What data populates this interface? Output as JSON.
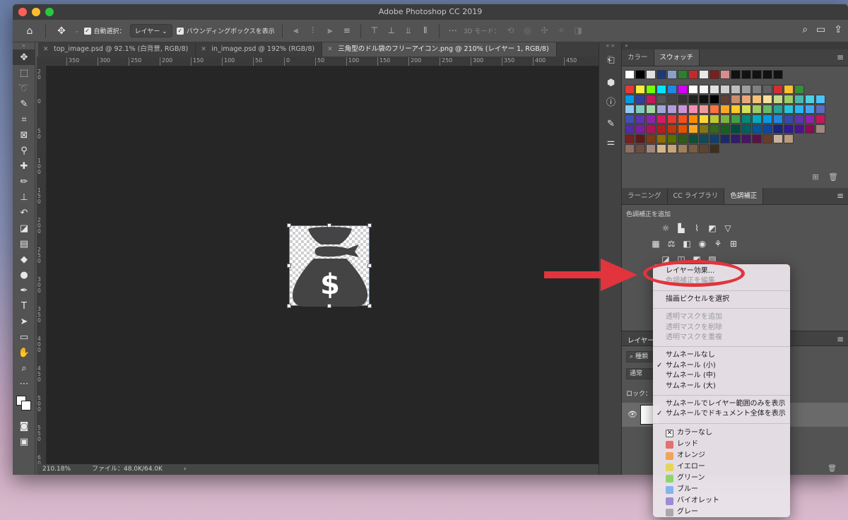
{
  "window": {
    "title": "Adobe Photoshop CC 2019"
  },
  "options_bar": {
    "auto_select_label": "自動選択：",
    "auto_select_value": "レイヤー",
    "bounding_box_label": "バウンディングボックスを表示",
    "mode_3d_label": "3D モード："
  },
  "tabs": [
    {
      "label": "top_image.psd @ 92.1% (白背景, RGB/8)"
    },
    {
      "label": "in_image.psd @ 192% (RGB/8)"
    },
    {
      "label": "三角型のドル袋のフリーアイコン.png @ 210% (レイヤー 1, RGB/8)"
    }
  ],
  "ruler_top": [
    "350",
    "300",
    "250",
    "200",
    "150",
    "100",
    "50",
    "0",
    "50",
    "100",
    "150",
    "200",
    "250",
    "300",
    "350",
    "400",
    "450"
  ],
  "ruler_left": [
    "2 0",
    "0",
    "5 0",
    "1 0 0",
    "1 5 0",
    "2 0 0",
    "2 5 0",
    "3 0 0",
    "3 5 0",
    "4 0 0",
    "4 5 0",
    "5 0 0",
    "5 5 0",
    "6 0 0"
  ],
  "status": {
    "zoom": "210.18%",
    "file": "ファイル：48.0K/64.0K",
    "chevron": "›"
  },
  "swatch_panel": {
    "tabs": [
      "カラー",
      "スウォッチ"
    ]
  },
  "adjust_panel": {
    "tabs": [
      "ラーニング",
      "CC ライブラリ",
      "色調補正"
    ],
    "heading": "色調補正を追加"
  },
  "layers_panel": {
    "tab": "レイヤー",
    "search": "種類",
    "blend": "通常",
    "lock": "ロック："
  },
  "context_menu": {
    "group1": [
      {
        "label": "レイヤー効果...",
        "enabled": true
      },
      {
        "label": "色調補正を編集...",
        "enabled": false
      }
    ],
    "group2": [
      {
        "label": "描画ピクセルを選択",
        "enabled": true
      }
    ],
    "group3": [
      {
        "label": "透明マスクを追加",
        "enabled": false
      },
      {
        "label": "透明マスクを削除",
        "enabled": false
      },
      {
        "label": "透明マスクを重複",
        "enabled": false
      }
    ],
    "group4": [
      {
        "label": "サムネールなし",
        "checked": false
      },
      {
        "label": "サムネール (小)",
        "checked": true
      },
      {
        "label": "サムネール (中)",
        "checked": false
      },
      {
        "label": "サムネール (大)",
        "checked": false
      }
    ],
    "group5": [
      {
        "label": "サムネールでレイヤー範囲のみを表示",
        "checked": false
      },
      {
        "label": "サムネールでドキュメント全体を表示",
        "checked": true
      }
    ],
    "colors": [
      {
        "label": "カラーなし",
        "color": "none"
      },
      {
        "label": "レッド",
        "color": "#e66f6f"
      },
      {
        "label": "オレンジ",
        "color": "#f0a35a"
      },
      {
        "label": "イエロー",
        "color": "#e6d45a"
      },
      {
        "label": "グリーン",
        "color": "#8fd46b"
      },
      {
        "label": "ブルー",
        "color": "#84b3ee"
      },
      {
        "label": "バイオレット",
        "color": "#9e8ad6"
      },
      {
        "label": "グレー",
        "color": "#a8a8a8"
      }
    ]
  },
  "colors": {
    "annotation_red": "#e2343d",
    "panel_bg": "#535353",
    "canvas_bg": "#262626"
  }
}
